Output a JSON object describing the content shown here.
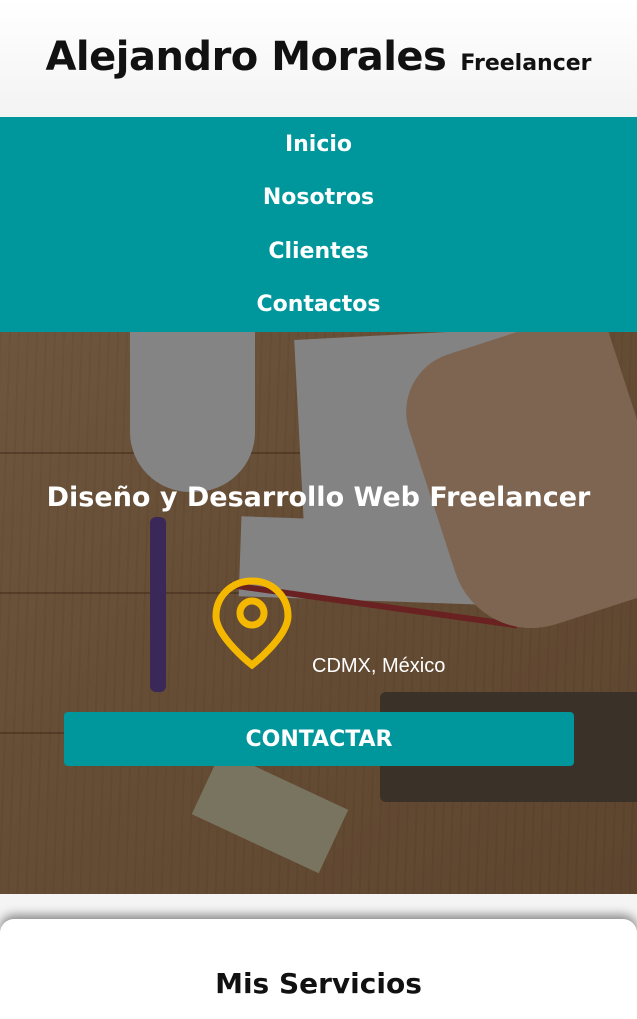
{
  "header": {
    "name": "Alejandro Morales",
    "tagline": "Freelancer"
  },
  "nav": {
    "items": [
      "Inicio",
      "Nosotros",
      "Clientes",
      "Contactos"
    ]
  },
  "hero": {
    "title": "Diseño y Desarrollo Web Freelancer",
    "location": "CDMX, México",
    "location_icon": "map-pin-icon",
    "cta_label": "CONTACTAR"
  },
  "services": {
    "title": "Mis Servicios"
  },
  "colors": {
    "accent": "#00979c",
    "pin": "#f5b800"
  }
}
